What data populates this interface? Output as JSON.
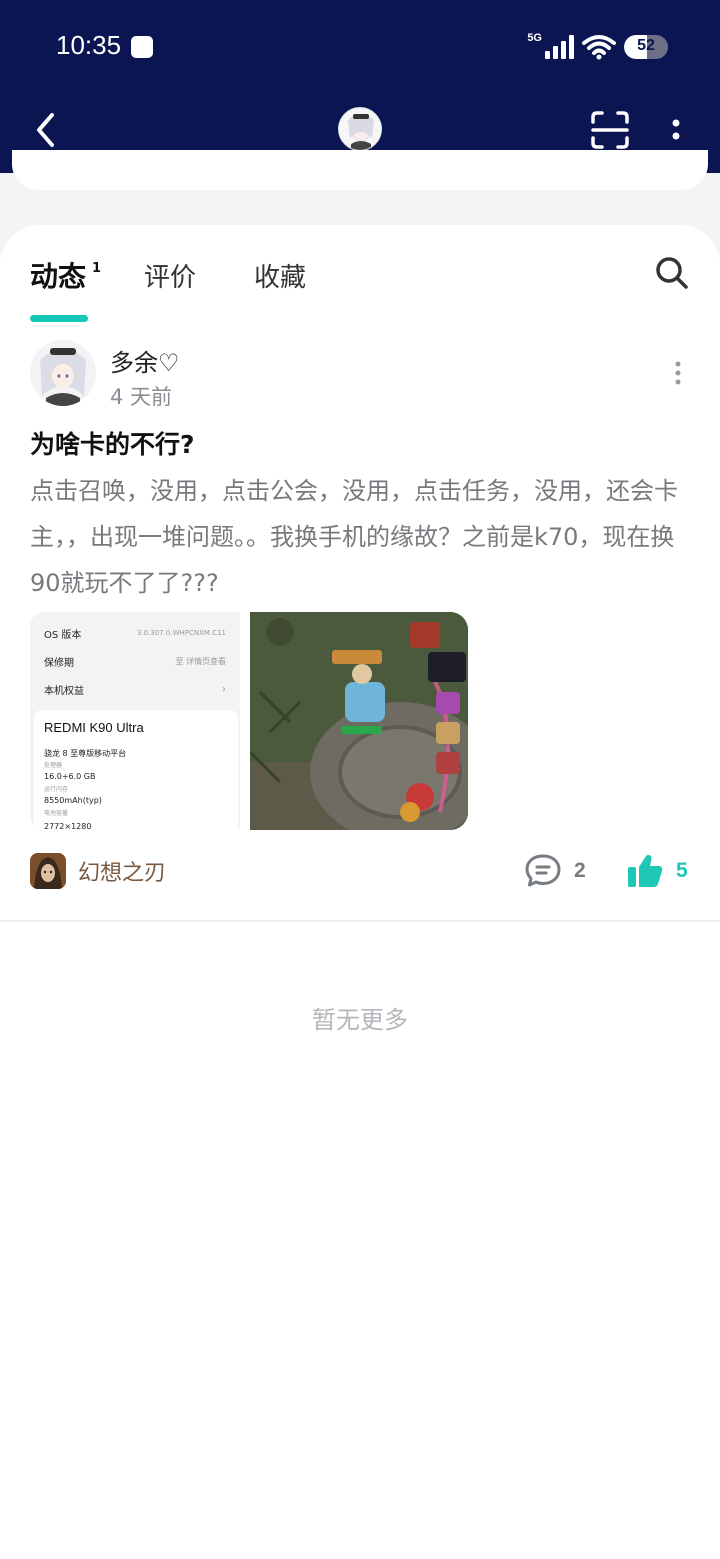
{
  "status_bar": {
    "time": "10:35",
    "network": "5G",
    "battery": "52",
    "battery_level": 0.52
  },
  "nav": {
    "back_icon": "chevron-left-icon",
    "scan_icon": "scan-icon",
    "more_icon": "more-vertical-icon"
  },
  "tabs": [
    {
      "label": "动态",
      "badge": "1",
      "active": true
    },
    {
      "label": "评价",
      "active": false
    },
    {
      "label": "收藏",
      "active": false
    }
  ],
  "post": {
    "user": "多余♡",
    "time": "4 天前",
    "title": "为啥卡的不行?",
    "body": "点击召唤，没用，点击公会，没用，点击任务，没用，还会卡主，，出现一堆问题。。我换手机的缘故？之前是k70，现在换90就玩不了了???",
    "screenshot_specs": {
      "os_label": "OS 版本",
      "os_value": "3.0.307.0.WHPCNXM.C11",
      "warranty_label": "保修期",
      "warranty_value": "至 详情页查看",
      "benefits_label": "本机权益",
      "model": "REDMI K90 Ultra",
      "chip": "骁龙 8 至尊版移动平台",
      "chip_sub": "处理器",
      "ram": "16.0+6.0 GB",
      "ram_sub": "运行内存",
      "battery": "8550mAh(typ)",
      "battery_sub": "电池容量",
      "resolution": "2772×1280"
    },
    "game_name": "幻想之刃",
    "comments": "2",
    "likes": "5"
  },
  "footer": {
    "no_more": "暂无更多"
  },
  "colors": {
    "header_bg": "#0a1551",
    "accent": "#14c8b8",
    "like": "#1fc7b6"
  }
}
